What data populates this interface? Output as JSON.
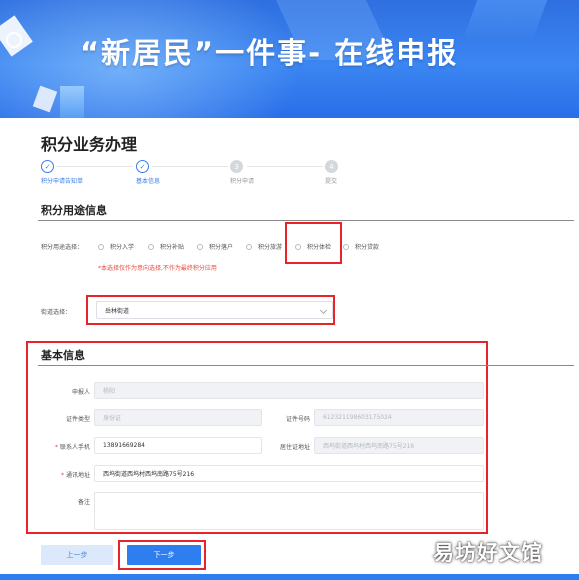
{
  "banner": {
    "title": "“新居民”一件事- 在线申报"
  },
  "page": {
    "title": "积分业务办理"
  },
  "steps": [
    {
      "label": "积分申请告知单",
      "state": "done",
      "mark": "✓"
    },
    {
      "label": "基本信息",
      "state": "done",
      "mark": "✓"
    },
    {
      "label": "积分申请",
      "state": "todo",
      "mark": "3"
    },
    {
      "label": "提交",
      "state": "todo",
      "mark": "4"
    }
  ],
  "usage": {
    "section_title": "积分用途信息",
    "select_label": "积分用途选择：",
    "options": [
      "积分入学",
      "积分补贴",
      "积分落户",
      "积分旅游",
      "积分体检",
      "积分贷款"
    ],
    "warning": "*本选择仅作为意向选择,不作为最终积分应用",
    "street_label": "街道选择：",
    "street_value": "岳林街道"
  },
  "basic": {
    "section_title": "基本信息",
    "applicant_label": "申报人",
    "applicant_value": "杨阳",
    "id_type_label": "证件类型",
    "id_type_value": "身份证",
    "id_number_label": "证件号码",
    "id_number_value": "61232119860317502​4",
    "phone_label": "联系人手机",
    "phone_value": "13891669284",
    "residence_label": "居住证地址",
    "residence_value": "西坞街道西坞村西坞南路75号216",
    "address_label": "通讯地址",
    "address_value": "西坞街道西坞村西坞南路75号216",
    "remark_label": "备注",
    "remark_value": ""
  },
  "buttons": {
    "prev": "上一步",
    "next": "下一步"
  },
  "watermark": "易坊好文馆"
}
